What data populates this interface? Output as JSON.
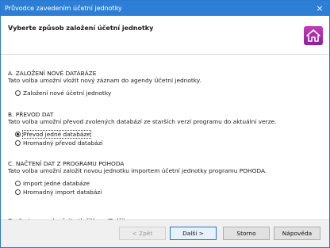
{
  "window": {
    "title": "Průvodce zavedením účetní jednotky",
    "close_glyph": "×"
  },
  "header": {
    "title": "Vyberte způsob založení účetní jednotky",
    "icon": "home-icon",
    "icon_color": "#a12ba6"
  },
  "sections": [
    {
      "title": "A. ZALOŽENÍ NOVÉ DATABÁZE",
      "description": "Tato volba umožní vložit nový záznam do agendy Účetní jednotky.",
      "options": [
        {
          "label": "Založení nové účetní jednotky",
          "selected": false
        }
      ]
    },
    {
      "title": "B. PŘEVOD DAT",
      "description": "Tato volba umožní převod zvolených databází ze starších verzí programu do aktuální verze.",
      "options": [
        {
          "label": "Převod jedné databáze",
          "selected": true
        },
        {
          "label": "Hromadný převod databází",
          "selected": false
        }
      ]
    },
    {
      "title": "C. NAČTENÍ DAT Z PROGRAMU POHODA",
      "description": "Tato volba umožní založit novou jednotku importem účetní jednotky programu POHODA.",
      "options": [
        {
          "label": "Import jedné databáze",
          "selected": false
        },
        {
          "label": "Hromadný import databází",
          "selected": false
        }
      ]
    }
  ],
  "hint": "Zvolte typ a pokračujte tlačítkem 'Další'.",
  "buttons": {
    "back": "< Zpět",
    "next": "Další >",
    "cancel": "Storno",
    "help": "Nápověda"
  },
  "colors": {
    "titlebar": "#2d7fd6",
    "accent": "#2a74c8"
  }
}
